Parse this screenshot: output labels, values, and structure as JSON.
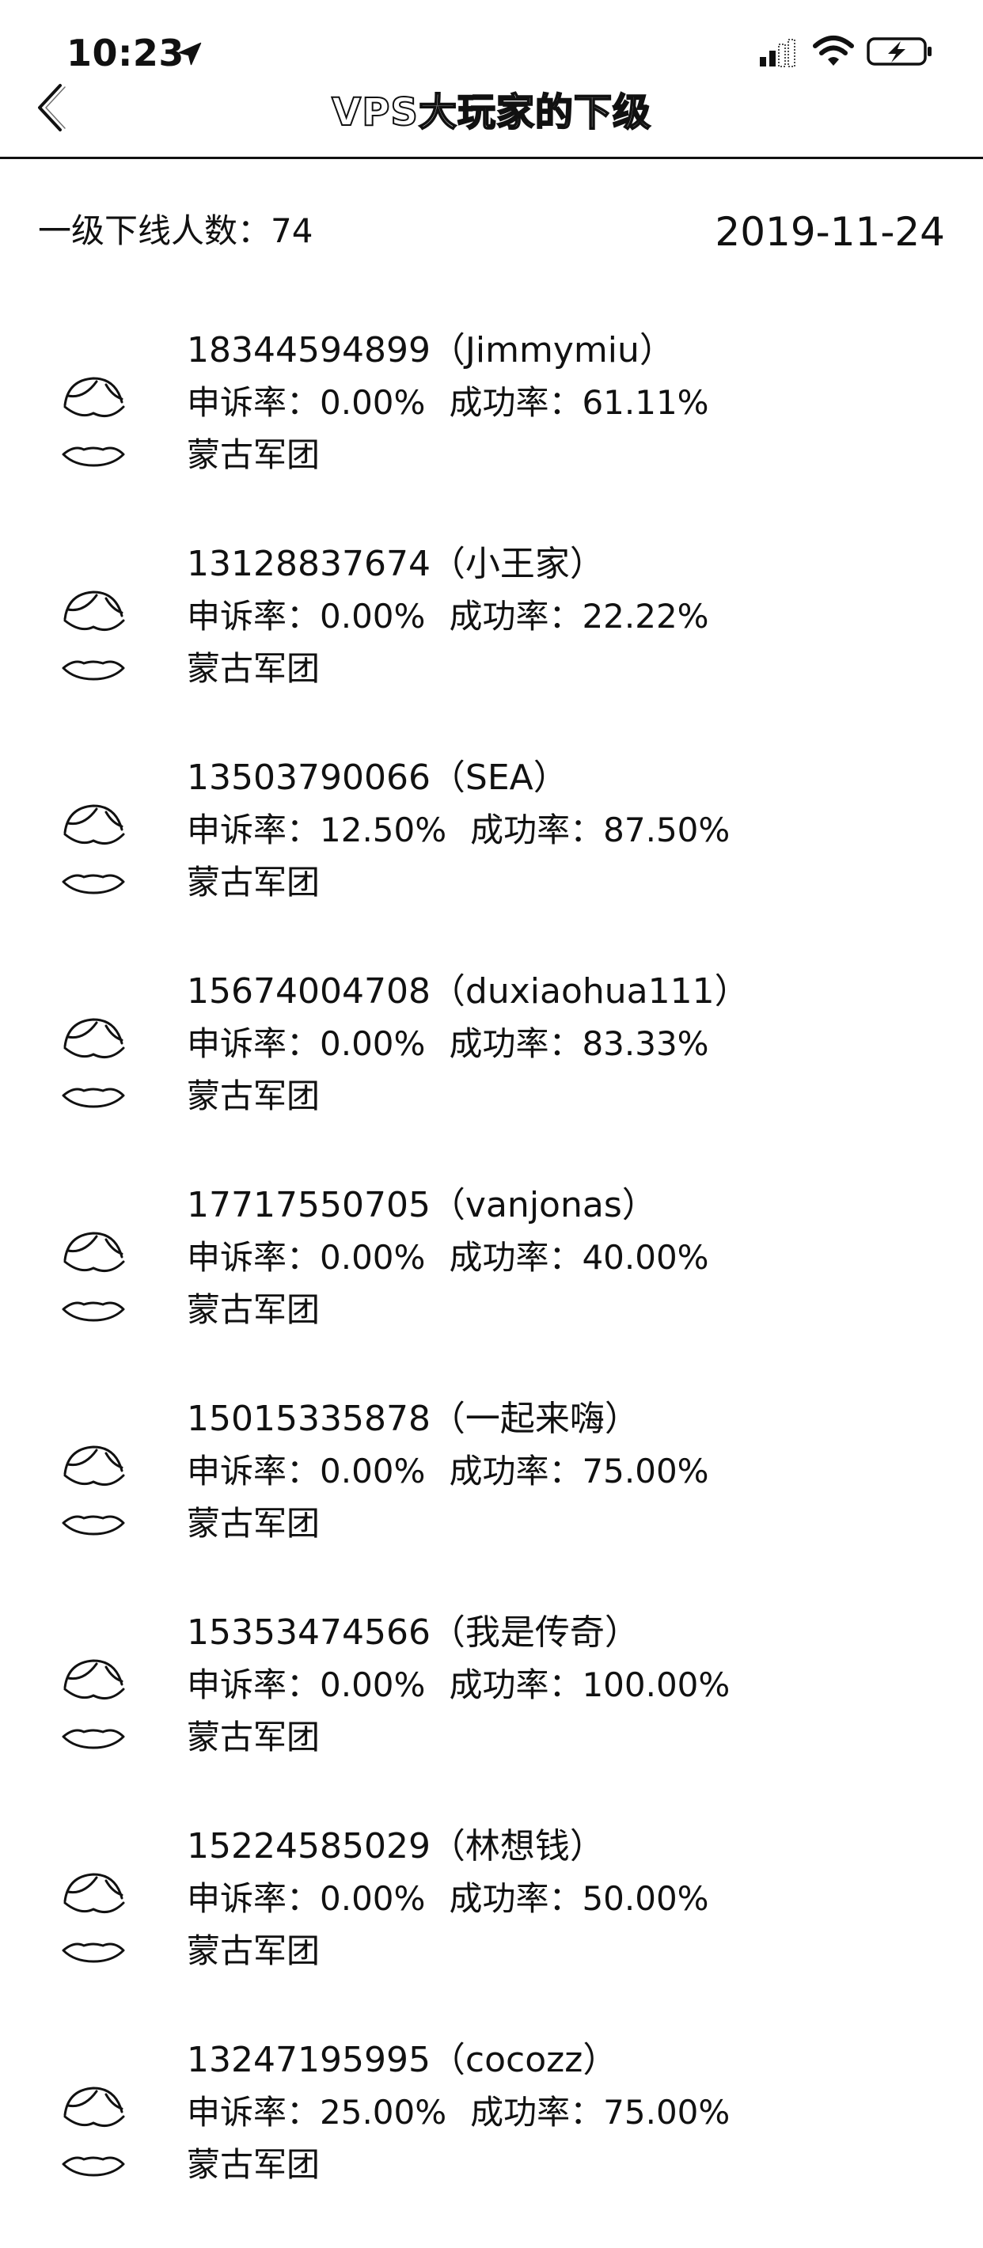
{
  "status_bar": {
    "time": "10:23",
    "icons": [
      "location-arrow-icon",
      "signal-icon",
      "wifi-icon",
      "battery-charging-icon"
    ]
  },
  "nav": {
    "back_icon": "chevron-left-icon",
    "title": "VPS大玩家的下级"
  },
  "summary": {
    "count_label": "一级下线人数：74",
    "date": "2019-11-24"
  },
  "members": [
    {
      "name": "18344594899（Jimmymiu）",
      "complaint": "申诉率：0.00%",
      "success": "成功率：61.11%",
      "team": "蒙古军团"
    },
    {
      "name": "13128837674（小王家）",
      "complaint": "申诉率：0.00%",
      "success": "成功率：22.22%",
      "team": "蒙古军团"
    },
    {
      "name": "13503790066（SEA）",
      "complaint": "申诉率：12.50%",
      "success": "成功率：87.50%",
      "team": "蒙古军团"
    },
    {
      "name": "15674004708（duxiaohua111）",
      "complaint": "申诉率：0.00%",
      "success": "成功率：83.33%",
      "team": "蒙古军团"
    },
    {
      "name": "17717550705（vanjonas）",
      "complaint": "申诉率：0.00%",
      "success": "成功率：40.00%",
      "team": "蒙古军团"
    },
    {
      "name": "15015335878（一起来嗨）",
      "complaint": "申诉率：0.00%",
      "success": "成功率：75.00%",
      "team": "蒙古军团"
    },
    {
      "name": "15353474566（我是传奇）",
      "complaint": "申诉率：0.00%",
      "success": "成功率：100.00%",
      "team": "蒙古军团"
    },
    {
      "name": "15224585029（林想钱）",
      "complaint": "申诉率：0.00%",
      "success": "成功率：50.00%",
      "team": "蒙古军团"
    },
    {
      "name": "13247195995（cocozz）",
      "complaint": "申诉率：25.00%",
      "success": "成功率：75.00%",
      "team": "蒙古军团"
    }
  ],
  "colors": {
    "text": "#111111",
    "background": "#ffffff"
  }
}
